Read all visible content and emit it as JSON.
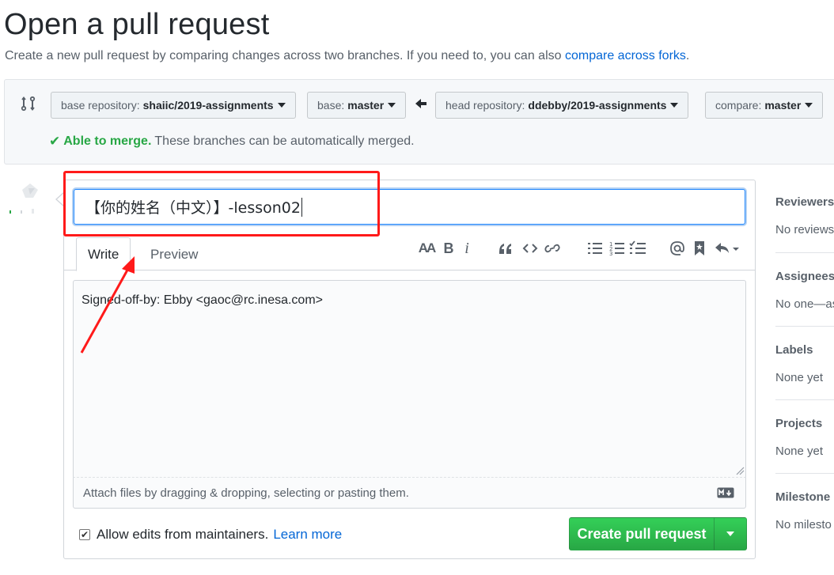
{
  "header": {
    "title": "Open a pull request",
    "subtitle": "Create a new pull request by comparing changes across two branches. If you need to, you can also",
    "subtitle_link": "compare across forks",
    "subtitle_end": "."
  },
  "compare": {
    "base_repo_label": "base repository:",
    "base_repo_value": "shaiic/2019-assignments",
    "base_label": "base:",
    "base_value": "master",
    "head_repo_label": "head repository:",
    "head_repo_value": "ddebby/2019-assignments",
    "compare_label": "compare:",
    "compare_value": "master",
    "merge_ok": "Able to merge.",
    "merge_text": "These branches can be automatically merged."
  },
  "form": {
    "title_value": "【你的姓名（中文）】-lesson02",
    "tabs": [
      {
        "label": "Write"
      },
      {
        "label": "Preview"
      }
    ],
    "body_value": "Signed-off-by: Ebby <gaoc@rc.inesa.com>",
    "drop_hint": "Attach files by dragging & dropping, selecting or pasting them.",
    "allow_edits_label": "Allow edits from maintainers.",
    "learn_more": "Learn more",
    "create_button": "Create pull request"
  },
  "toolbar": {
    "heading": "AA",
    "bold": "B",
    "italic": "i"
  },
  "sidebar": {
    "reviewers": {
      "label": "Reviewers",
      "value": "No reviews"
    },
    "assignees": {
      "label": "Assignees",
      "value": "No one—as"
    },
    "labels": {
      "label": "Labels",
      "value": "None yet"
    },
    "projects": {
      "label": "Projects",
      "value": "None yet"
    },
    "milestone": {
      "label": "Milestone",
      "value": "No milesto"
    }
  },
  "colors": {
    "accent_blue": "#0366d6",
    "success_green": "#28a745",
    "annotation_red": "#ff1a1a"
  }
}
